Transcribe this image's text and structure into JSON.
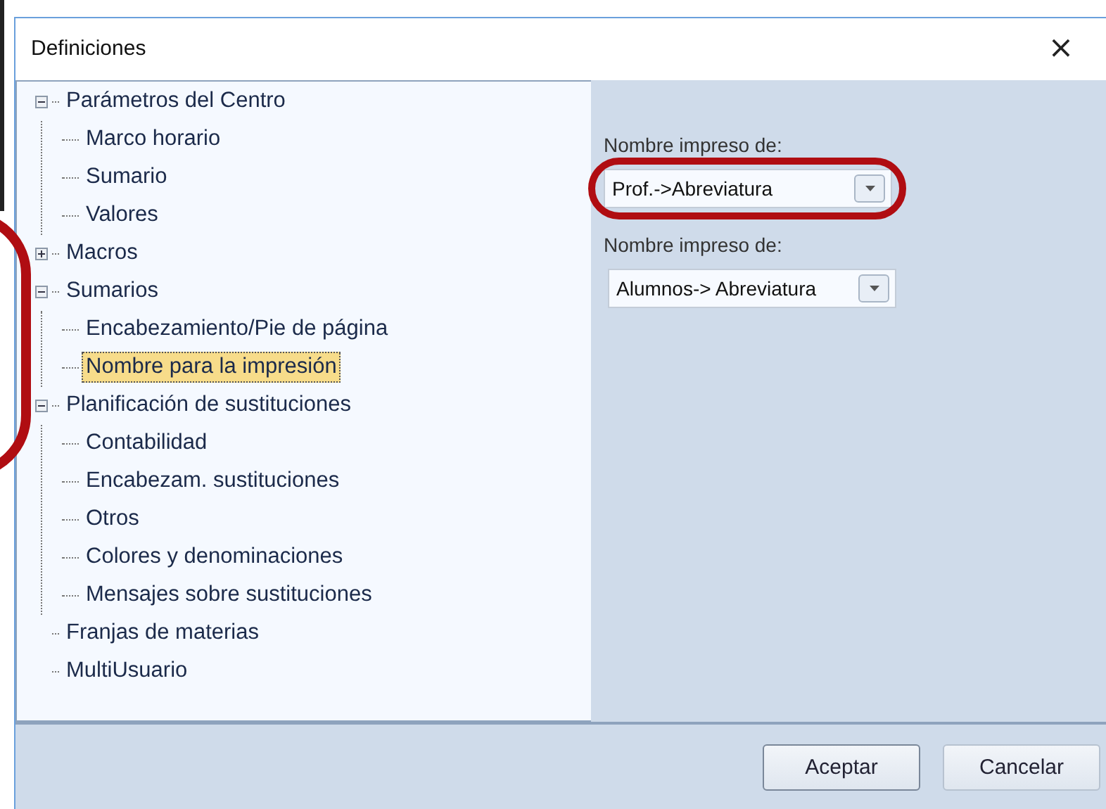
{
  "window": {
    "title": "Definiciones",
    "close": "×"
  },
  "tree": [
    {
      "label": "Parámetros del Centro",
      "expanded": true,
      "selected": false,
      "children": [
        {
          "label": "Marco horario",
          "selected": false
        },
        {
          "label": "Sumario",
          "selected": false
        },
        {
          "label": "Valores",
          "selected": false
        }
      ]
    },
    {
      "label": "Macros",
      "expanded": false,
      "selected": false
    },
    {
      "label": "Sumarios",
      "expanded": true,
      "selected": false,
      "children": [
        {
          "label": "Encabezamiento/Pie de página",
          "selected": false
        },
        {
          "label": "Nombre para la impresión",
          "selected": true
        }
      ]
    },
    {
      "label": "Planificación de sustituciones",
      "expanded": true,
      "selected": false,
      "children": [
        {
          "label": "Contabilidad",
          "selected": false
        },
        {
          "label": "Encabezam. sustituciones",
          "selected": false
        },
        {
          "label": "Otros",
          "selected": false
        },
        {
          "label": "Colores y denominaciones",
          "selected": false
        },
        {
          "label": "Mensajes sobre sustituciones",
          "selected": false
        }
      ]
    },
    {
      "label": "Franjas de materias",
      "selected": false
    },
    {
      "label": "MultiUsuario",
      "selected": false
    }
  ],
  "fields": [
    {
      "label": "Nombre impreso de:",
      "value": "Prof.->Abreviatura",
      "highlighted": true
    },
    {
      "label": "Nombre impreso de:",
      "value": "Alumnos-> Abreviatura",
      "highlighted": false
    }
  ],
  "buttons": [
    {
      "label": "Aceptar",
      "default": true
    },
    {
      "label": "Cancelar",
      "default": false
    }
  ]
}
